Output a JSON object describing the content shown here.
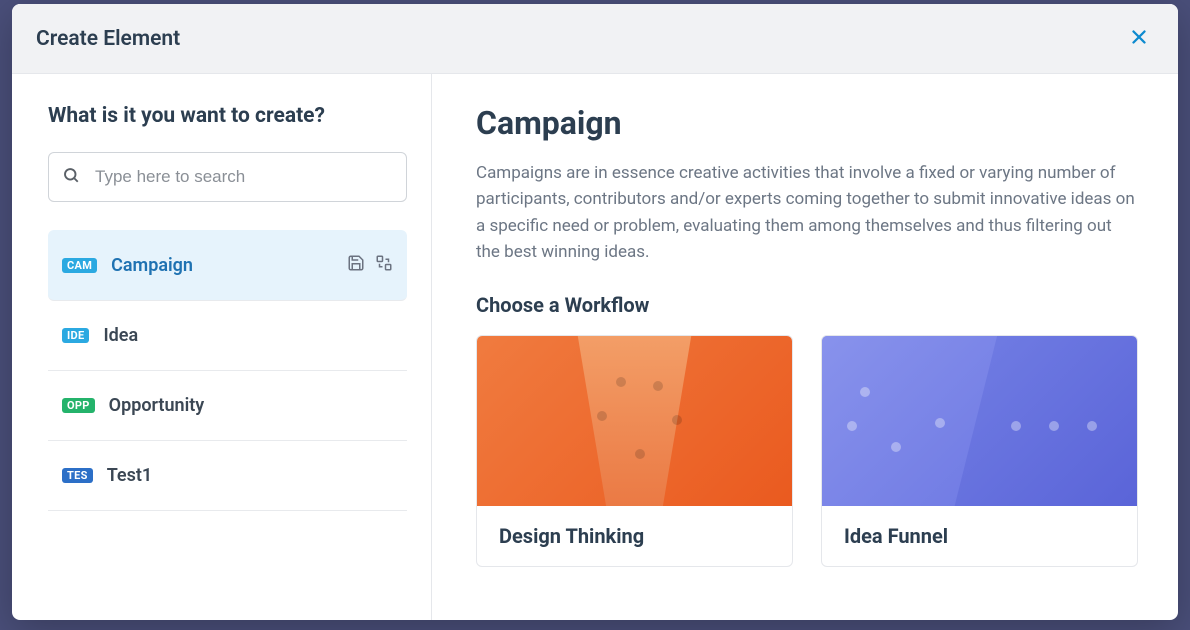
{
  "dialog": {
    "title": "Create Element"
  },
  "left": {
    "title": "What is it you want to create?",
    "search_placeholder": "Type here to search",
    "types": [
      {
        "badge": "CAM",
        "label": "Campaign",
        "color": "#2ba9e1",
        "selected": true
      },
      {
        "badge": "IDE",
        "label": "Idea",
        "color": "#2ba9e1",
        "selected": false
      },
      {
        "badge": "OPP",
        "label": "Opportunity",
        "color": "#24b36b",
        "selected": false
      },
      {
        "badge": "TES",
        "label": "Test1",
        "color": "#2c6fc7",
        "selected": false
      }
    ]
  },
  "detail": {
    "title": "Campaign",
    "description": "Campaigns are in essence creative activities that involve a fixed or varying number of participants, contributors and/or experts coming together to submit innovative ideas on a specific need or problem, evaluating them among themselves and thus filtering out the best winning ideas.",
    "workflow_heading": "Choose a Workflow",
    "workflows": [
      {
        "label": "Design Thinking"
      },
      {
        "label": "Idea Funnel"
      }
    ]
  }
}
